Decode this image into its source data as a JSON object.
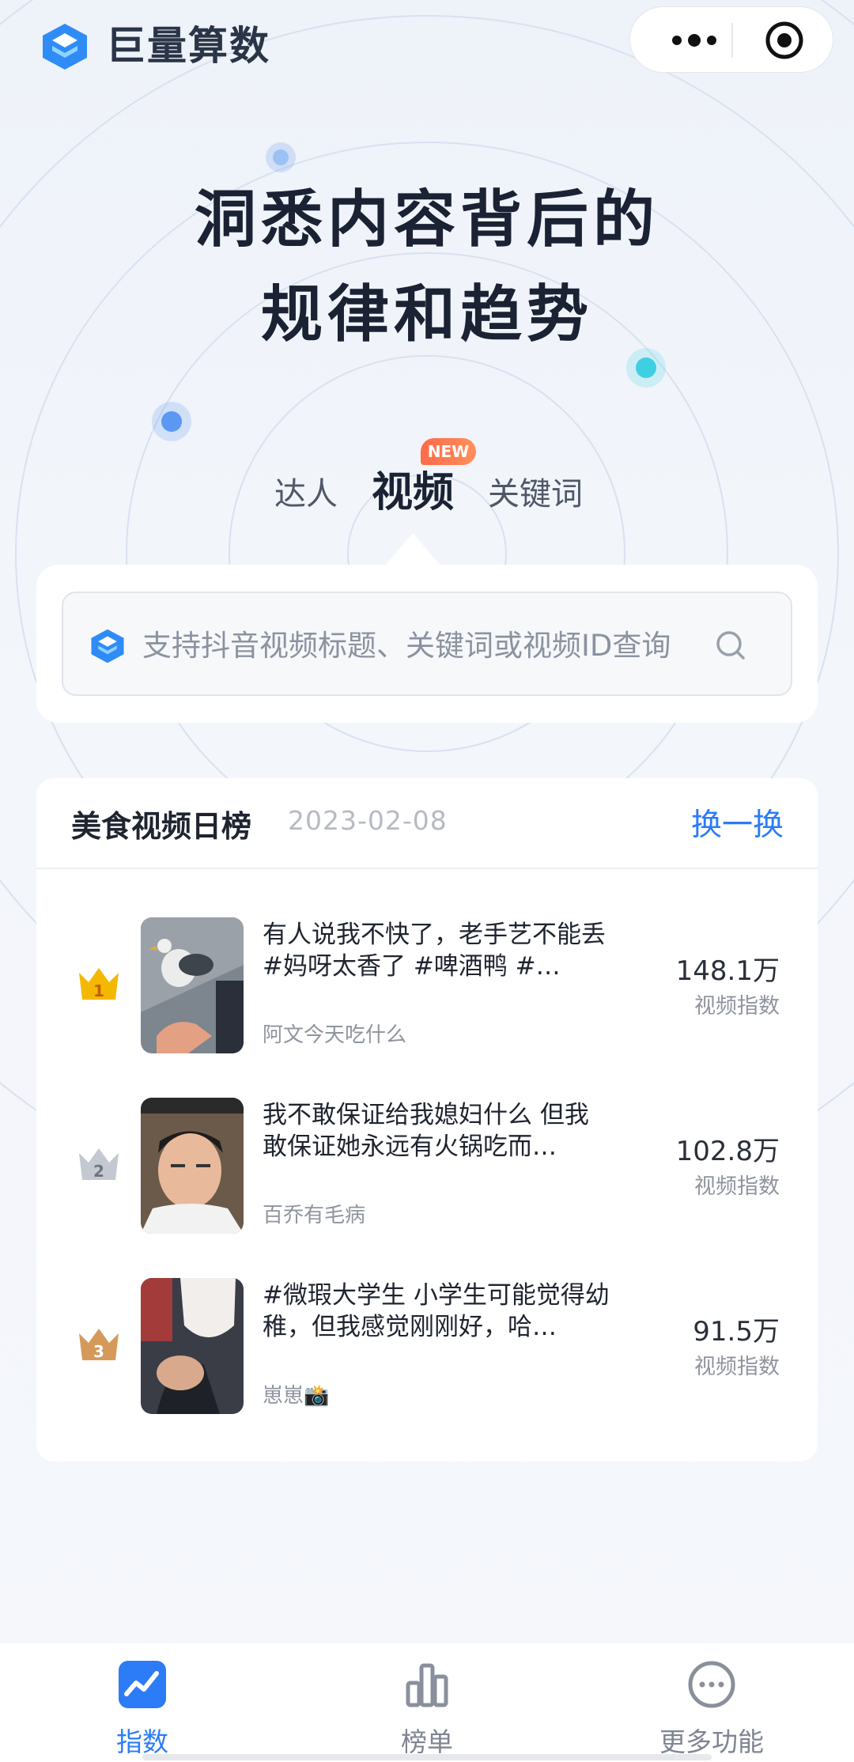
{
  "app": {
    "brand": "巨量算数"
  },
  "hero": {
    "line1": "洞悉内容背后的",
    "line2": "规律和趋势"
  },
  "tabs": {
    "items": [
      {
        "label": "达人",
        "active": false
      },
      {
        "label": "视频",
        "active": true
      },
      {
        "label": "关键词",
        "active": false
      }
    ],
    "new_badge": "NEW"
  },
  "search": {
    "placeholder": "支持抖音视频标题、关键词或视频ID查询"
  },
  "ranking": {
    "title": "美食视频日榜",
    "date": "2023-02-08",
    "refresh_label": "换一换",
    "rows": [
      {
        "rank": "1",
        "title": "有人说我不快了，老手艺不能丢 #妈呀太香了 #啤酒鸭 #…",
        "author": "阿文今天吃什么",
        "index_value": "148.1万",
        "index_label": "视频指数"
      },
      {
        "rank": "2",
        "title": "我不敢保证给我媳妇什么 但我敢保证她永远有火锅吃而…",
        "author": "百乔有毛病",
        "index_value": "102.8万",
        "index_label": "视频指数"
      },
      {
        "rank": "3",
        "title": "#微瑕大学生 小学生可能觉得幼稚，但我感觉刚刚好，哈…",
        "author": "崽崽📸",
        "index_value": "91.5万",
        "index_label": "视频指数"
      }
    ]
  },
  "bottom_nav": {
    "items": [
      {
        "label": "指数",
        "icon": "trend-chart-icon",
        "active": true
      },
      {
        "label": "榜单",
        "icon": "bar-chart-icon",
        "active": false
      },
      {
        "label": "更多功能",
        "icon": "more-circle-icon",
        "active": false
      }
    ]
  },
  "colors": {
    "accent": "#2b7cf6",
    "badge": "#ff6b4a",
    "gold": "#f5b800",
    "silver": "#b8bcc6",
    "bronze": "#c98a4a"
  }
}
